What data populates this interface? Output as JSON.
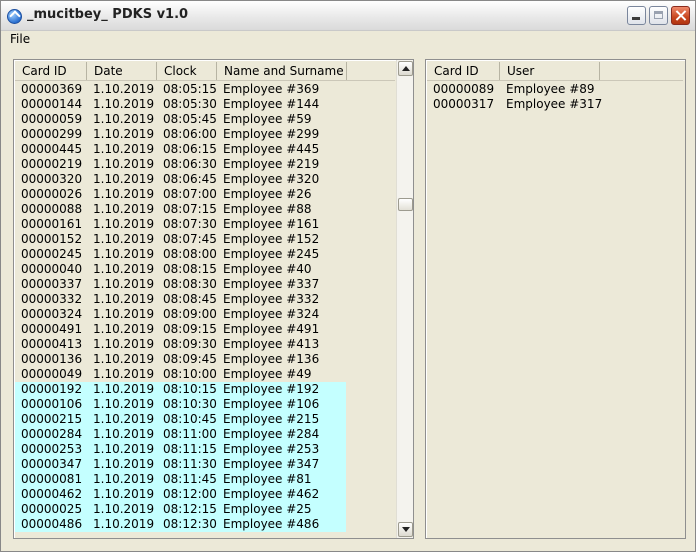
{
  "window": {
    "title": "_mucitbey_ PDKS v1.0"
  },
  "menu": {
    "file": "File"
  },
  "log_list": {
    "columns": [
      "Card ID",
      "Date",
      "Clock",
      "Name and Surname"
    ],
    "rows": [
      [
        "00000369",
        "1.10.2019",
        "08:05:15",
        "Employee #369"
      ],
      [
        "00000144",
        "1.10.2019",
        "08:05:30",
        "Employee #144"
      ],
      [
        "00000059",
        "1.10.2019",
        "08:05:45",
        "Employee #59"
      ],
      [
        "00000299",
        "1.10.2019",
        "08:06:00",
        "Employee #299"
      ],
      [
        "00000445",
        "1.10.2019",
        "08:06:15",
        "Employee #445"
      ],
      [
        "00000219",
        "1.10.2019",
        "08:06:30",
        "Employee #219"
      ],
      [
        "00000320",
        "1.10.2019",
        "08:06:45",
        "Employee #320"
      ],
      [
        "00000026",
        "1.10.2019",
        "08:07:00",
        "Employee #26"
      ],
      [
        "00000088",
        "1.10.2019",
        "08:07:15",
        "Employee #88"
      ],
      [
        "00000161",
        "1.10.2019",
        "08:07:30",
        "Employee #161"
      ],
      [
        "00000152",
        "1.10.2019",
        "08:07:45",
        "Employee #152"
      ],
      [
        "00000245",
        "1.10.2019",
        "08:08:00",
        "Employee #245"
      ],
      [
        "00000040",
        "1.10.2019",
        "08:08:15",
        "Employee #40"
      ],
      [
        "00000337",
        "1.10.2019",
        "08:08:30",
        "Employee #337"
      ],
      [
        "00000332",
        "1.10.2019",
        "08:08:45",
        "Employee #332"
      ],
      [
        "00000324",
        "1.10.2019",
        "08:09:00",
        "Employee #324"
      ],
      [
        "00000491",
        "1.10.2019",
        "08:09:15",
        "Employee #491"
      ],
      [
        "00000413",
        "1.10.2019",
        "08:09:30",
        "Employee #413"
      ],
      [
        "00000136",
        "1.10.2019",
        "08:09:45",
        "Employee #136"
      ],
      [
        "00000049",
        "1.10.2019",
        "08:10:00",
        "Employee #49"
      ],
      [
        "00000192",
        "1.10.2019",
        "08:10:15",
        "Employee #192"
      ],
      [
        "00000106",
        "1.10.2019",
        "08:10:30",
        "Employee #106"
      ],
      [
        "00000215",
        "1.10.2019",
        "08:10:45",
        "Employee #215"
      ],
      [
        "00000284",
        "1.10.2019",
        "08:11:00",
        "Employee #284"
      ],
      [
        "00000253",
        "1.10.2019",
        "08:11:15",
        "Employee #253"
      ],
      [
        "00000347",
        "1.10.2019",
        "08:11:30",
        "Employee #347"
      ],
      [
        "00000081",
        "1.10.2019",
        "08:11:45",
        "Employee #81"
      ],
      [
        "00000462",
        "1.10.2019",
        "08:12:00",
        "Employee #462"
      ],
      [
        "00000025",
        "1.10.2019",
        "08:12:15",
        "Employee #25"
      ],
      [
        "00000486",
        "1.10.2019",
        "08:12:30",
        "Employee #486"
      ]
    ],
    "highlighted_from_row": 20,
    "highlight_color": "#c4ffff",
    "scroll_position": 0.28
  },
  "user_list": {
    "columns": [
      "Card ID",
      "User"
    ],
    "rows": [
      [
        "00000089",
        "Employee #89"
      ],
      [
        "00000317",
        "Employee #317"
      ]
    ]
  }
}
